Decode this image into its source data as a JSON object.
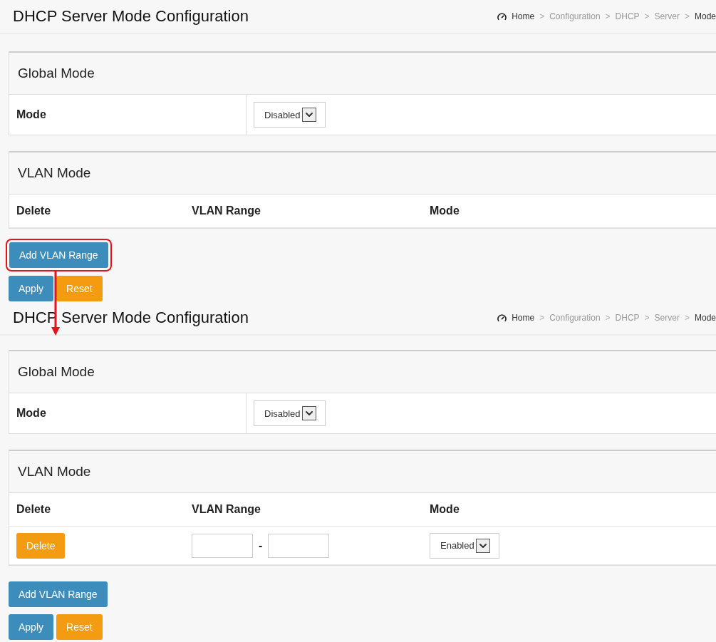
{
  "panels": [
    {
      "title": "DHCP Server Mode Configuration",
      "breadcrumb_separator": ">",
      "breadcrumb": [
        {
          "label": "Home",
          "kind": "home"
        },
        {
          "label": "Configuration",
          "kind": "link"
        },
        {
          "label": "DHCP",
          "kind": "link"
        },
        {
          "label": "Server",
          "kind": "link"
        },
        {
          "label": "Mode",
          "kind": "current"
        }
      ],
      "global_mode": {
        "heading": "Global Mode",
        "label": "Mode",
        "select": "Disabled"
      },
      "vlan_mode": {
        "heading": "VLAN Mode",
        "columns": [
          "Delete",
          "VLAN Range",
          "Mode"
        ]
      },
      "add_button": {
        "label": "Add VLAN Range",
        "highlighted": true
      },
      "buttons": [
        {
          "label": "Apply",
          "kind": "primary"
        },
        {
          "label": "Reset",
          "kind": "warning"
        }
      ]
    },
    {
      "title": "DHCP Server Mode Configuration",
      "breadcrumb_separator": ">",
      "breadcrumb": [
        {
          "label": "Home",
          "kind": "home"
        },
        {
          "label": "Configuration",
          "kind": "link"
        },
        {
          "label": "DHCP",
          "kind": "link"
        },
        {
          "label": "Server",
          "kind": "link"
        },
        {
          "label": "Mode",
          "kind": "current"
        }
      ],
      "global_mode": {
        "heading": "Global Mode",
        "label": "Mode",
        "select": "Disabled"
      },
      "vlan_mode": {
        "heading": "VLAN Mode",
        "columns": [
          "Delete",
          "VLAN Range",
          "Mode"
        ],
        "rows": [
          {
            "delete": "Delete",
            "separator": "-",
            "mode": "Enabled"
          }
        ]
      },
      "add_button": {
        "label": "Add VLAN Range",
        "highlighted": false
      },
      "buttons": [
        {
          "label": "Apply",
          "kind": "primary"
        },
        {
          "label": "Reset",
          "kind": "warning"
        }
      ]
    }
  ]
}
